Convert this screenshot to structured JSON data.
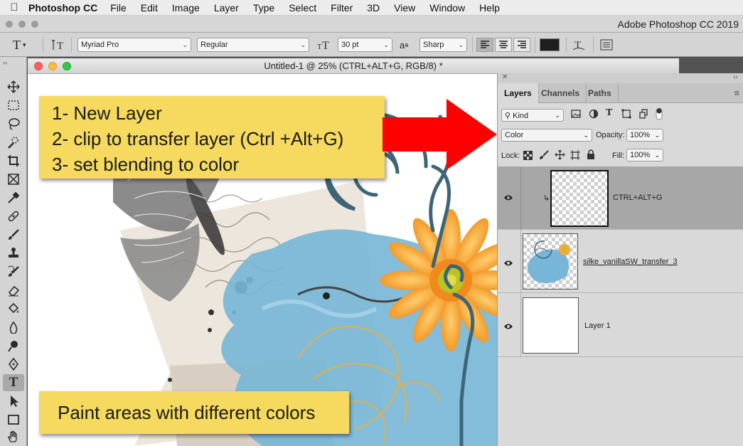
{
  "menubar": {
    "app_name": "Photoshop CC",
    "items": [
      "File",
      "Edit",
      "Image",
      "Layer",
      "Type",
      "Select",
      "Filter",
      "3D",
      "View",
      "Window",
      "Help"
    ]
  },
  "app_title": "Adobe Photoshop CC 2019",
  "options_bar": {
    "tool_glyph": "T",
    "orient_glyph": "I̲T",
    "font_family": "Myriad Pro",
    "font_style": "Regular",
    "size_glyph": "ᴛT",
    "font_size": "30 pt",
    "aa_glyph": "aₐ",
    "anti_alias": "Sharp",
    "text_color": "#1e1e1e"
  },
  "document": {
    "title": "Untitled-1 @ 25% (CTRL+ALT+G, RGB/8) *"
  },
  "callouts": {
    "steps": [
      "1- New Layer",
      "2- clip to transfer layer (Ctrl +Alt+G)",
      "3- set blending to color"
    ],
    "paint": "Paint areas with different colors"
  },
  "arrow_color": "#ff0000",
  "layers_panel": {
    "tabs": [
      "Layers",
      "Channels",
      "Paths"
    ],
    "filter_label": "Kind",
    "blend_mode": "Color",
    "opacity_label": "Opacity:",
    "opacity_value": "100%",
    "lock_label": "Lock:",
    "fill_label": "Fill:",
    "fill_value": "100%",
    "layers": [
      {
        "name": "CTRL+ALT+G",
        "clipped": true,
        "selected": true
      },
      {
        "name": "silke_vanillaSW_transfer_3",
        "clipped": false,
        "selected": false
      },
      {
        "name": "Layer 1",
        "clipped": false,
        "selected": false
      }
    ]
  }
}
